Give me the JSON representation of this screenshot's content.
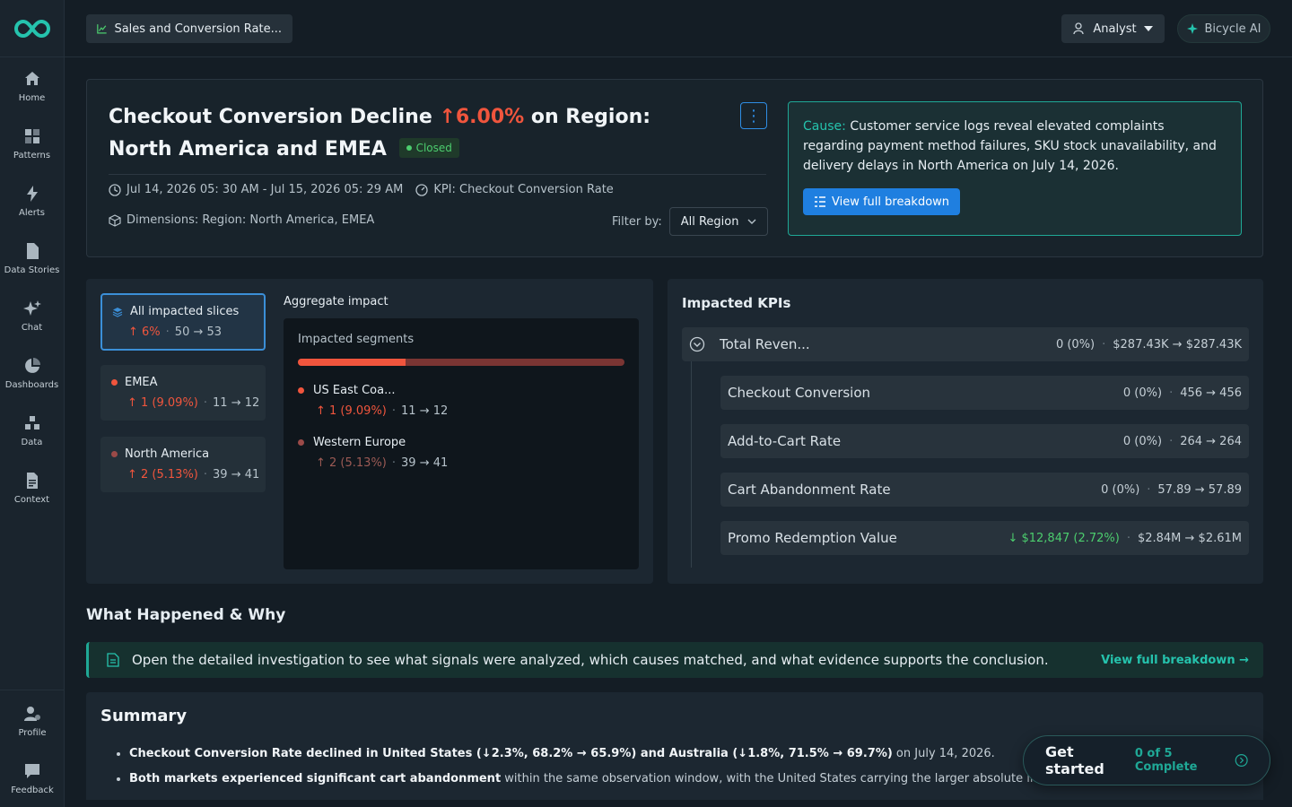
{
  "header": {
    "title": "Sales and Conversion Rate...",
    "role": "Analyst",
    "ai_label": "Bicycle AI"
  },
  "sidebar": {
    "items": [
      {
        "label": "Home"
      },
      {
        "label": "Patterns"
      },
      {
        "label": "Alerts"
      },
      {
        "label": "Data Stories"
      },
      {
        "label": "Chat"
      },
      {
        "label": "Dashboards"
      },
      {
        "label": "Data"
      },
      {
        "label": "Context"
      }
    ],
    "bottom": [
      {
        "label": "Profile"
      },
      {
        "label": "Feedback"
      }
    ]
  },
  "incident": {
    "title_prefix": "Checkout Conversion Decline",
    "change_pct": "6.00%",
    "title_suffix": "on Region: North America and EMEA",
    "status": "Closed",
    "time_range": "Jul 14, 2026 05: 30 AM - Jul 15, 2026 05: 29 AM",
    "kpi": "KPI: Checkout Conversion Rate",
    "dimensions": "Dimensions: Region: North America, EMEA",
    "filter_label": "Filter by:",
    "filter_value": "All Region"
  },
  "cause": {
    "label": "Cause:",
    "text": "Customer service logs reveal elevated complaints regarding payment method failures, SKU stock unavailability, and delivery delays in North America on July 14, 2026.",
    "button": "View full breakdown"
  },
  "slices": [
    {
      "name": "All impacted slices",
      "change": "6%",
      "range": "50 → 53",
      "color": "#3b8fd8"
    },
    {
      "name": "EMEA",
      "change": "1 (9.09%)",
      "range": "11 → 12",
      "color": "#f0553d"
    },
    {
      "name": "North America",
      "change": "2 (5.13%)",
      "range": "39 → 41",
      "color": "#9b4a48"
    }
  ],
  "aggregate": {
    "label": "Aggregate impact",
    "subtitle": "Impacted segments",
    "fill_fraction": 0.33,
    "segments": [
      {
        "name": "US East Coa...",
        "change": "1 (9.09%)",
        "range": "11 → 12"
      },
      {
        "name": "Western Europe",
        "change": "2 (5.13%)",
        "range": "39 → 41"
      }
    ]
  },
  "kpis": {
    "title": "Impacted KPIs",
    "root": {
      "name": "Total Reven...",
      "delta": "0 (0%)",
      "range": "$287.43K → $287.43K"
    },
    "children": [
      {
        "name": "Checkout Conversion",
        "delta": "0 (0%)",
        "range": "456 → 456"
      },
      {
        "name": "Add-to-Cart Rate",
        "delta": "0 (0%)",
        "range": "264 → 264"
      },
      {
        "name": "Cart Abandonment Rate",
        "delta": "0 (0%)",
        "range": "57.89 → 57.89"
      },
      {
        "name": "Promo Redemption Value",
        "delta": "$12,847 (2.72%)",
        "range": "$2.84M → $2.61M"
      }
    ]
  },
  "what_happened": {
    "title": "What Happened & Why",
    "banner": "Open the detailed investigation to see what signals were analyzed, which causes matched, and what evidence supports the conclusion.",
    "link": "View full breakdown →"
  },
  "summary": {
    "title": "Summary",
    "b1_bold": "Checkout Conversion Rate declined in United States (↓2.3%, 68.2% → 65.9%) and Australia (↓1.8%, 71.5% → 69.7%)",
    "b1_rest": " on July 14, 2026.",
    "b2_bold": "Both markets experienced significant cart abandonment",
    "b2_rest": " within the same observation window, with the United States carrying the larger absolute impact."
  },
  "onboarding": {
    "title": "Get started",
    "progress": "0 of 5 Complete"
  }
}
